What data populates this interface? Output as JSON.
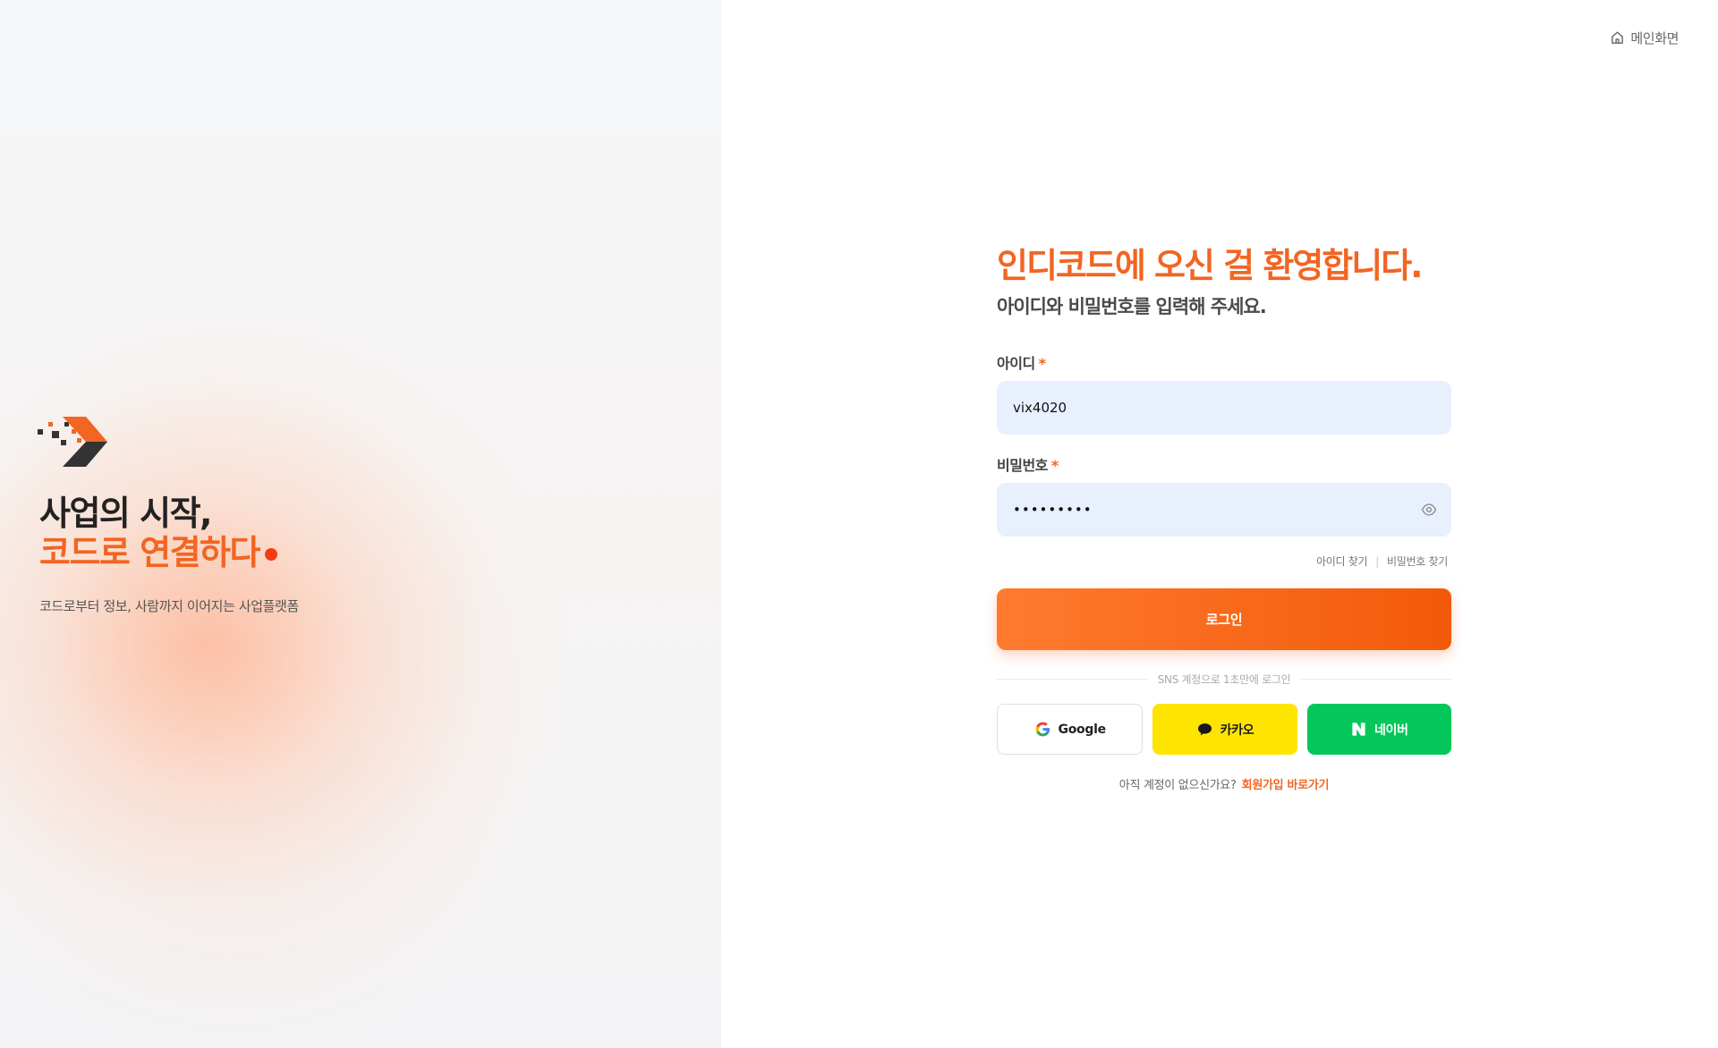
{
  "left": {
    "headline_line1": "사업의 시작,",
    "headline_line2": "코드로 연결하다",
    "tagline": "코드로부터 정보, 사람까지 이어지는 사업플랫폼"
  },
  "header": {
    "home_label": "메인화면",
    "home_icon": "home-icon"
  },
  "form": {
    "welcome": "인디코드에 오신 걸 환영합니다.",
    "subtitle": "아이디와 비밀번호를 입력해 주세요.",
    "id_label": "아이디",
    "id_required": "*",
    "id_value": "vix4020",
    "pw_label": "비밀번호",
    "pw_required": "*",
    "pw_value": "•••••••••",
    "find_id": "아이디 찾기",
    "find_pw": "비밀번호 찾기",
    "login_label": "로그인",
    "sns_divider": "SNS 계정으로 1초만에 로그인",
    "google_label": "Google",
    "kakao_label": "카카오",
    "naver_label": "네이버",
    "signup_prompt": "아직 계정이 없으신가요?",
    "signup_link": "회원가입 바로가기"
  },
  "colors": {
    "accent": "#f26522",
    "kakao": "#fee500",
    "naver": "#03c75a",
    "input_bg": "#e8f0fe"
  }
}
